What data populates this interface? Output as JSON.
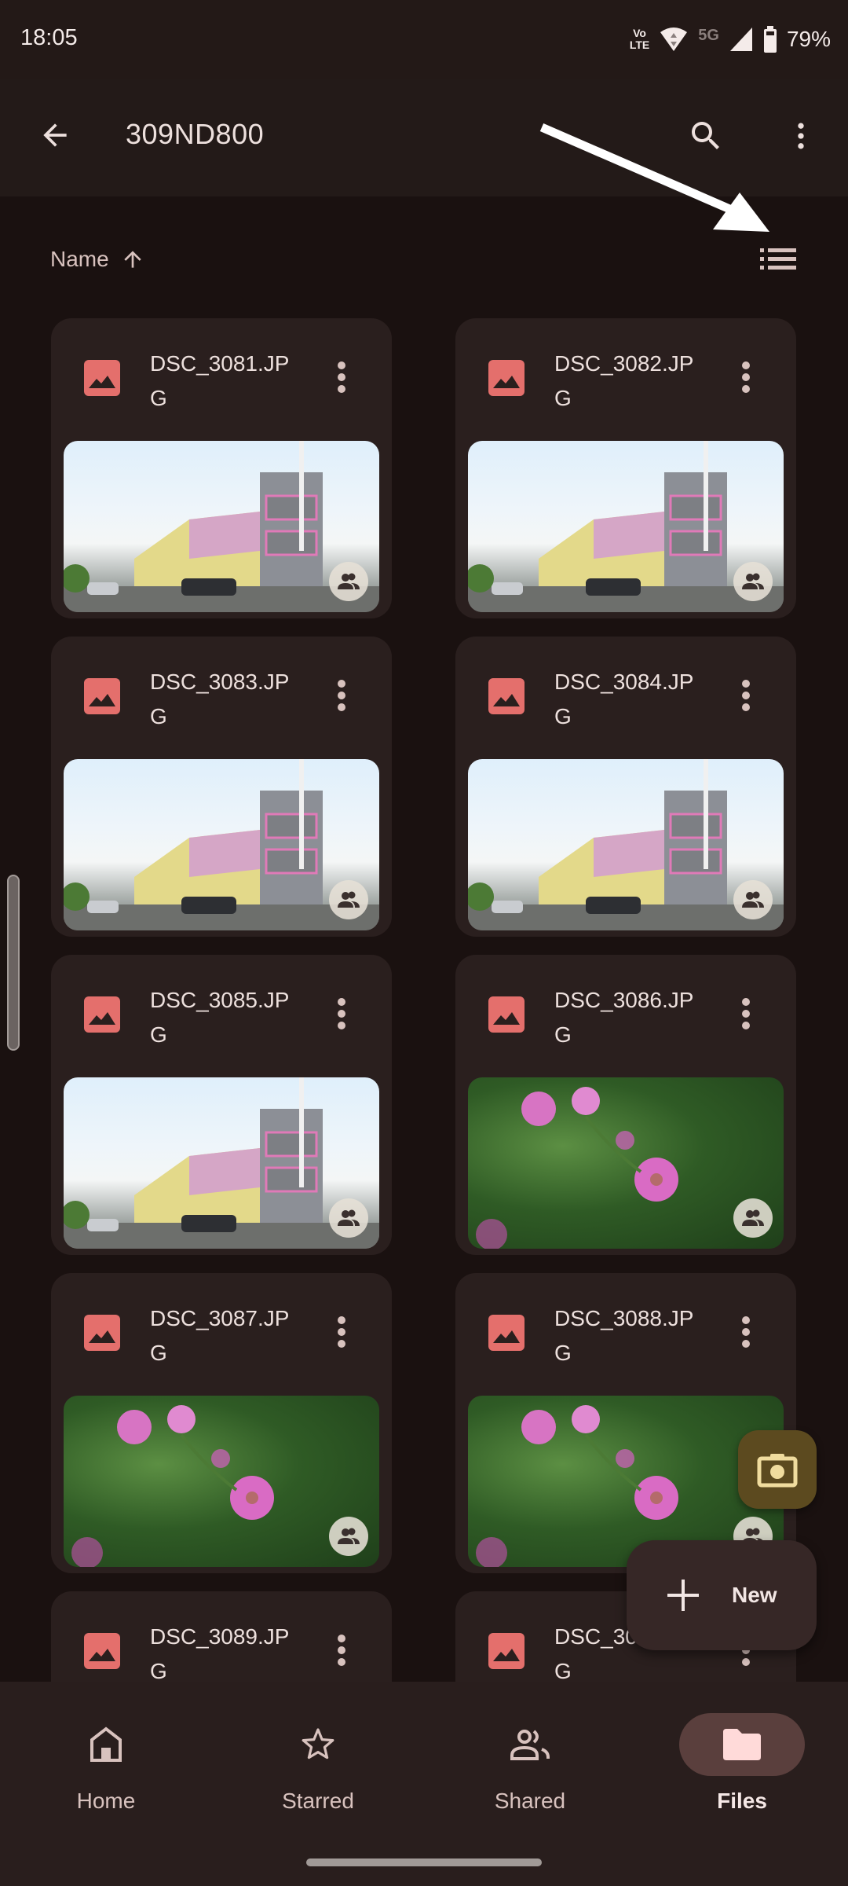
{
  "status_bar": {
    "time": "18:05",
    "volte_top": "Vo",
    "volte_bottom": "LTE",
    "network": "5G",
    "battery": "79%"
  },
  "app_bar": {
    "title": "309ND800",
    "back_icon": "arrow-back-icon",
    "search_icon": "search-icon",
    "more_icon": "more-vert-icon"
  },
  "sort": {
    "label": "Name",
    "direction_icon": "arrow-upward-icon",
    "view_toggle_icon": "list-view-icon"
  },
  "files": [
    {
      "name": "DSC_3081.JPG",
      "thumb": "building",
      "shared": true
    },
    {
      "name": "DSC_3082.JPG",
      "thumb": "building",
      "shared": true
    },
    {
      "name": "DSC_3083.JPG",
      "thumb": "building",
      "shared": true
    },
    {
      "name": "DSC_3084.JPG",
      "thumb": "building",
      "shared": true
    },
    {
      "name": "DSC_3085.JPG",
      "thumb": "building",
      "shared": true
    },
    {
      "name": "DSC_3086.JPG",
      "thumb": "flower",
      "shared": true
    },
    {
      "name": "DSC_3087.JPG",
      "thumb": "flower",
      "shared": true
    },
    {
      "name": "DSC_3088.JPG",
      "thumb": "flower",
      "shared": true
    },
    {
      "name": "DSC_3089.JPG",
      "thumb": "",
      "shared": false
    },
    {
      "name": "DSC_3090.JPG",
      "thumb": "",
      "shared": false
    }
  ],
  "fab": {
    "camera_icon": "camera-icon",
    "new_label": "New"
  },
  "bottom_nav": {
    "items": [
      {
        "label": "Home",
        "icon": "home-icon",
        "active": false
      },
      {
        "label": "Starred",
        "icon": "star-icon",
        "active": false
      },
      {
        "label": "Shared",
        "icon": "people-icon",
        "active": false
      },
      {
        "label": "Files",
        "icon": "folder-icon",
        "active": true
      }
    ]
  },
  "colors": {
    "background": "#1a1110",
    "card": "#2a1f1e",
    "image_icon": "#e46f6c",
    "camera_fab": "#5c4a1f",
    "active_nav_pill": "#5a3f3d"
  }
}
